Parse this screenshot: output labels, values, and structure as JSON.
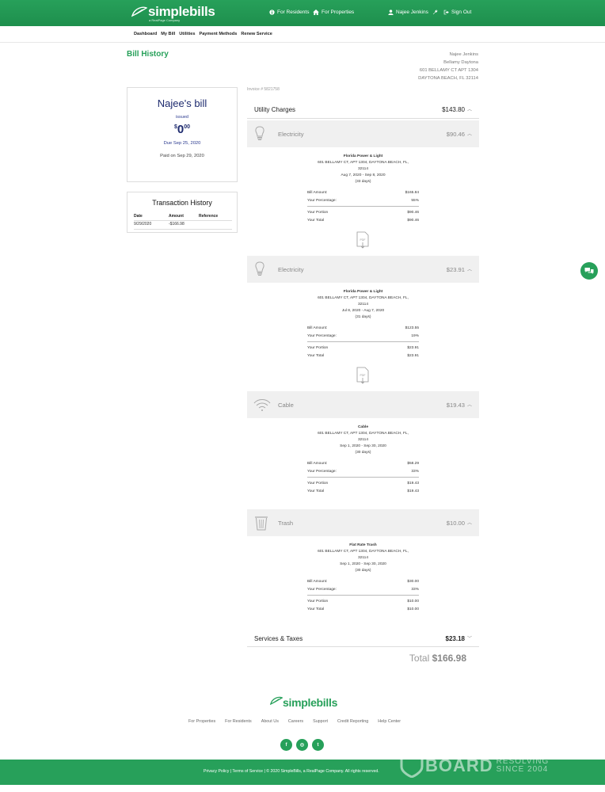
{
  "header": {
    "logo_text": "simplebills",
    "logo_tagline": "a RealPage Company",
    "for_residents": "For Residents",
    "for_properties": "For Properties",
    "user_name": "Najee Jenkins",
    "sign_out": "Sign Out",
    "bg_color": "#27a05a"
  },
  "subnav": {
    "items": [
      "Dashboard",
      "My Bill",
      "Utilities",
      "Payment Methods",
      "Renew Service"
    ]
  },
  "page": {
    "title": "Bill History",
    "address": {
      "name": "Najee Jenkins",
      "community": "Bellamy Daytona",
      "street": "601 BELLAMY CT APT 1304",
      "city": "DAYTONA BEACH, FL 32114"
    }
  },
  "bill_card": {
    "name": "Najee's bill",
    "status": "issued",
    "amount_dollar": "$",
    "amount_int": "0",
    "amount_cents": "00",
    "due": "Due Sep 25, 2020",
    "paid": "Paid on Sep 29, 2020"
  },
  "transactions": {
    "title": "Transaction History",
    "headers": [
      "Date",
      "Amount",
      "Reference"
    ],
    "rows": [
      {
        "date": "9/29/2020",
        "amount": "-$166.98",
        "reference": ""
      }
    ]
  },
  "invoice": {
    "number": "Invoice # 5821758",
    "utility_charges_label": "Utility Charges",
    "utility_charges_amount": "$143.80",
    "services_label": "Services & Taxes",
    "services_amount": "$23.18",
    "total_label": "Total",
    "total_amount": "$166.98"
  },
  "segments": [
    {
      "icon": "lightbulb-icon",
      "label": "Electricity",
      "amount": "$90.46",
      "provider": "Florida Power & Light",
      "address1": "601 BELLAMY CT, APT 1304, DAYTONA BEACH, FL,",
      "address2": "32114",
      "period": "Aug 7, 2020 - Sep 8, 2020",
      "days": "(33 days)",
      "bill_amount_label": "Bill Amount:",
      "bill_amount": "$165.84",
      "percentage_label": "Your Percentage:",
      "percentage": "55%",
      "portion_label": "Your Portion",
      "portion": "$90.46",
      "total_label": "Your Total",
      "total": "$90.46",
      "has_pdf": true
    },
    {
      "icon": "lightbulb-icon",
      "label": "Electricity",
      "amount": "$23.91",
      "provider": "Florida Power & Light",
      "address1": "601 BELLAMY CT, APT 1304, DAYTONA BEACH, FL,",
      "address2": "32114",
      "period": "Jul 8, 2020 - Aug 7, 2020",
      "days": "(31 days)",
      "bill_amount_label": "Bill Amount:",
      "bill_amount": "$123.55",
      "percentage_label": "Your Percentage:",
      "percentage": "19%",
      "portion_label": "Your Portion",
      "portion": "$23.91",
      "total_label": "Your Total",
      "total": "$23.91",
      "has_pdf": true
    },
    {
      "icon": "wifi-icon",
      "label": "Cable",
      "amount": "$19.43",
      "provider": "Cable",
      "address1": "601 BELLAMY CT, APT 1304, DAYTONA BEACH, FL,",
      "address2": "32114",
      "period": "Sep 1, 2020 - Sep 30, 2020",
      "days": "(30 days)",
      "bill_amount_label": "Bill Amount:",
      "bill_amount": "$58.29",
      "percentage_label": "Your Percentage:",
      "percentage": "33%",
      "portion_label": "Your Portion",
      "portion": "$19.43",
      "total_label": "Your Total",
      "total": "$19.43",
      "has_pdf": false
    },
    {
      "icon": "trash-icon",
      "label": "Trash",
      "amount": "$10.00",
      "provider": "Flat Rate Trash",
      "address1": "601 BELLAMY CT, APT 1304, DAYTONA BEACH, FL,",
      "address2": "32114",
      "period": "Sep 1, 2020 - Sep 30, 2020",
      "days": "(30 days)",
      "bill_amount_label": "Bill Amount:",
      "bill_amount": "$30.00",
      "percentage_label": "Your Percentage:",
      "percentage": "33%",
      "portion_label": "Your Portion",
      "portion": "$10.00",
      "total_label": "Your Total",
      "total": "$10.00",
      "has_pdf": false
    }
  ],
  "pdf_label": "PDF",
  "footer": {
    "logo_text": "simplebills",
    "links": [
      "For Properties",
      "For Residents",
      "About Us",
      "Careers",
      "Support",
      "Credit Reporting",
      "Help Center"
    ],
    "socials": [
      {
        "icon": "facebook-icon",
        "glyph": "f"
      },
      {
        "icon": "instagram-icon",
        "glyph": "◎"
      },
      {
        "icon": "twitter-icon",
        "glyph": "t"
      }
    ],
    "legal": "Privacy Policy  |  Terms of Service  |  © 2020 SimpleBills, a RealPage Company. All rights reserved.",
    "watermark_big": "BOARD",
    "watermark_line1": "RESOLVING",
    "watermark_line2": "SINCE 2004"
  }
}
